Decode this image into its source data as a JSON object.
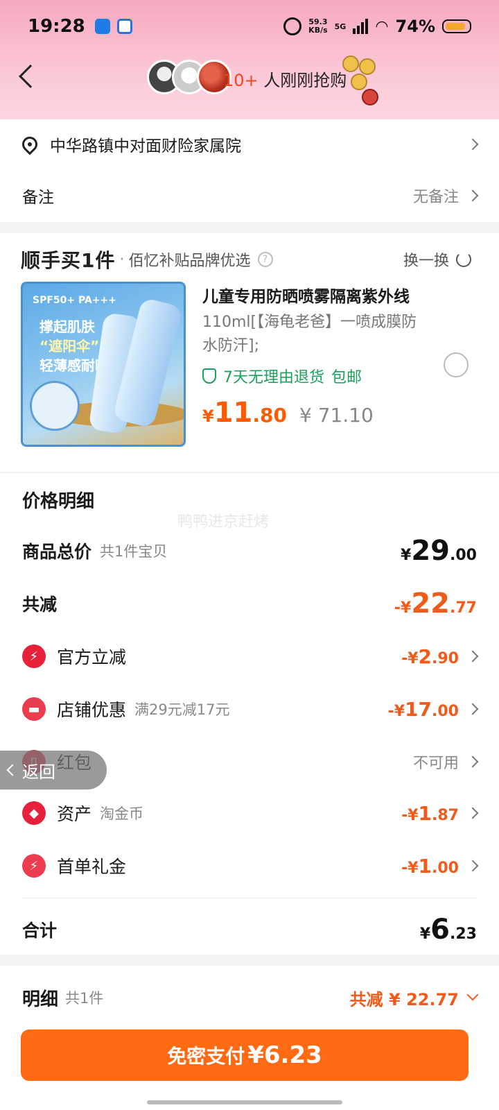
{
  "status_bar": {
    "time": "19:28",
    "net_speed": "59.3",
    "net_unit": "KB/s",
    "network": "5G",
    "battery": "74%"
  },
  "nav": {
    "grab_count": "10+",
    "grab_text": " 人刚刚抢购"
  },
  "address": {
    "text": "中华路镇中对面财险家属院"
  },
  "note": {
    "label": "备注",
    "value": "无备注"
  },
  "recommend": {
    "brand": "顺手买1件",
    "dot": "·",
    "subtitle": "佰忆补贴品牌优选",
    "help": "?",
    "swap": "换一换",
    "product": {
      "image_badge": "SPF50+ PA+++",
      "image_line1": "撑起肌肤",
      "image_line2": "“遮阳伞”",
      "image_line3": "轻薄感耐晒",
      "title": "儿童专用防晒喷雾隔离紫外线",
      "desc": "110ml[【海龟老爸】一喷成膜防水防汗];",
      "badge_return": "7天无理由退货",
      "badge_ship": "包邮",
      "price_symbol": "¥",
      "price_int": "11",
      "price_dec": ".80",
      "price_old": "¥ 71.10"
    }
  },
  "detail": {
    "title": "价格明细",
    "watermark": "鸭鸭进京赶烤",
    "rows": [
      {
        "label": "商品总价",
        "sub": "共1件宝贝",
        "sym": "¥",
        "int": "29",
        "dec": ".00"
      },
      {
        "label": "共减",
        "sub": "",
        "sym": "-¥",
        "int": "22",
        "dec": ".77"
      },
      {
        "label": "官方立减",
        "sub": "",
        "sym": "-¥",
        "int": "2",
        "dec": ".90"
      },
      {
        "label": "店铺优惠",
        "sub": "满29元减17元",
        "sym": "-¥",
        "int": "17",
        "dec": ".00"
      },
      {
        "label": "红包",
        "sub": "",
        "value": "不可用"
      },
      {
        "label": "资产",
        "sub": "淘金币",
        "sym": "-¥",
        "int": "1",
        "dec": ".87"
      },
      {
        "label": "首单礼金",
        "sub": "",
        "sym": "-¥",
        "int": "1",
        "dec": ".00"
      }
    ],
    "total_label": "合计",
    "total_sym": "¥",
    "total_int": "6",
    "total_dec": ".23"
  },
  "float_back": "返回",
  "bottom": {
    "title": "明细",
    "count": "共1件",
    "save": "共减 ¥ 22.77",
    "pay_label": "免密支付",
    "pay_amount": "¥6.23"
  },
  "colors": {
    "accent": "#ff6a13",
    "discount": "#f05a1a",
    "green": "#19a05a"
  }
}
